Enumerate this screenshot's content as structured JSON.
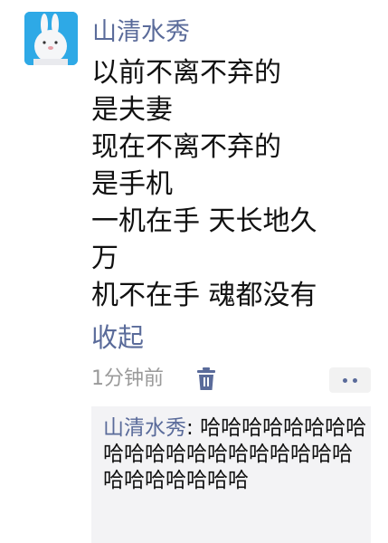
{
  "post": {
    "author": "山清水秀",
    "lines": [
      "以前不离不弃的",
      "是夫妻",
      "现在不离不弃的",
      "是手机",
      "一机在手 天长地久",
      "万",
      "机不在手 魂都没有"
    ],
    "collapse_label": "收起",
    "time": "1分钟前"
  },
  "comment": {
    "author": "山清水秀",
    "separator": ": ",
    "text": "哈哈哈哈哈哈哈哈哈哈哈哈哈哈哈哈哈哈哈哈哈哈哈哈哈哈哈"
  },
  "icons": {
    "avatar": "rabbit-avatar",
    "delete": "trash-icon",
    "more": "more-dots-icon"
  },
  "colors": {
    "link": "#5a6b9a",
    "time": "#9a9a9a",
    "comment_bg": "#f3f3f5",
    "avatar_bg": "#2ea9e6"
  }
}
